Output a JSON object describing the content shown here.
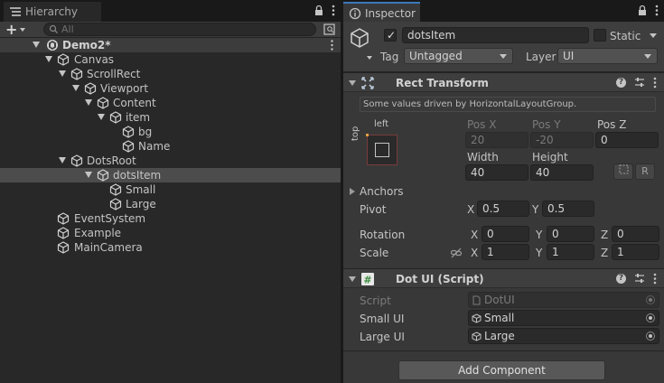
{
  "hierarchy": {
    "tab_label": "Hierarchy",
    "search_placeholder": "All",
    "scene_name": "Demo2*",
    "items": [
      {
        "label": "Canvas"
      },
      {
        "label": "ScrollRect"
      },
      {
        "label": "Viewport"
      },
      {
        "label": "Content"
      },
      {
        "label": "item"
      },
      {
        "label": "bg"
      },
      {
        "label": "Name"
      },
      {
        "label": "DotsRoot"
      },
      {
        "label": "dotsItem"
      },
      {
        "label": "Small"
      },
      {
        "label": "Large"
      },
      {
        "label": "EventSystem"
      },
      {
        "label": "Example"
      },
      {
        "label": "MainCamera"
      }
    ]
  },
  "inspector": {
    "tab_label": "Inspector",
    "object_name": "dotsItem",
    "static_label": "Static",
    "tag_label": "Tag",
    "tag_value": "Untagged",
    "layer_label": "Layer",
    "layer_value": "UI",
    "rect_transform": {
      "title": "Rect Transform",
      "note": "Some values driven by HorizontalLayoutGroup.",
      "anchor_h": "left",
      "anchor_v": "top",
      "pos_x_label": "Pos X",
      "pos_y_label": "Pos Y",
      "pos_z_label": "Pos Z",
      "pos_x": "20",
      "pos_y": "-20",
      "pos_z": "0",
      "width_label": "Width",
      "height_label": "Height",
      "width": "40",
      "height": "40",
      "r_button": "R",
      "anchors_label": "Anchors",
      "pivot_label": "Pivot",
      "pivot_x": "0.5",
      "pivot_y": "0.5",
      "rotation_label": "Rotation",
      "rot_x": "0",
      "rot_y": "0",
      "rot_z": "0",
      "scale_label": "Scale",
      "scale_x": "1",
      "scale_y": "1",
      "scale_z": "1",
      "x": "X",
      "y": "Y",
      "z": "Z"
    },
    "dot_ui": {
      "title": "Dot UI (Script)",
      "script_label": "Script",
      "script_value": "DotUI",
      "small_label": "Small UI",
      "small_value": "Small",
      "large_label": "Large UI",
      "large_value": "Large"
    },
    "add_component": "Add Component"
  }
}
